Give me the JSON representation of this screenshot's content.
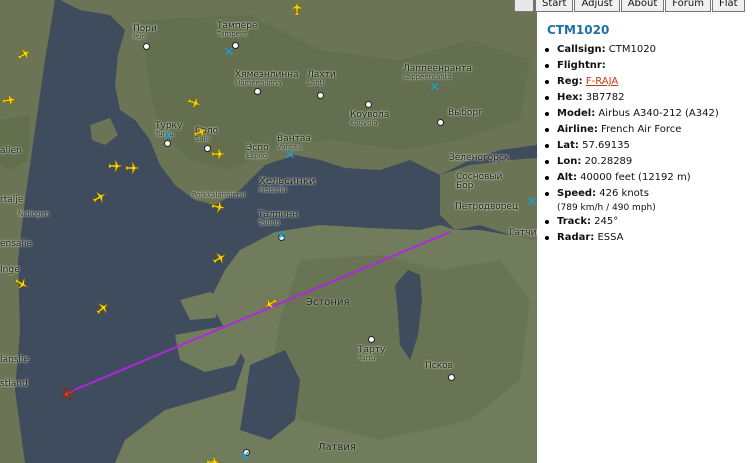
{
  "tabs": [
    "Start",
    "Adjust",
    "About",
    "Forum",
    "Flat"
  ],
  "flight": {
    "title": "CTM1020",
    "fields": [
      {
        "label": "Callsign:",
        "value": "CTM1020"
      },
      {
        "label": "Flightnr:",
        "value": ""
      },
      {
        "label": "Reg:",
        "value": "F-RAJA",
        "link": true
      },
      {
        "label": "Hex:",
        "value": "3B7782"
      },
      {
        "label": "Model:",
        "value": "Airbus A340-212 (A342)"
      },
      {
        "label": "Airline:",
        "value": "French Air Force"
      },
      {
        "label": "Lat:",
        "value": "57.69135"
      },
      {
        "label": "Lon:",
        "value": "20.28289"
      },
      {
        "label": "Alt:",
        "value": "40000 feet (12192 m)"
      },
      {
        "label": "Speed:",
        "value": "426 knots",
        "sub": "(789 km/h / 490 mph)"
      },
      {
        "label": "Track:",
        "value": "245°"
      },
      {
        "label": "Radar:",
        "value": "ESSA"
      }
    ]
  },
  "map": {
    "cities": [
      {
        "ru": "Пори",
        "lat": "Pori"
      },
      {
        "ru": "Тампере",
        "lat": "Tampere"
      },
      {
        "ru": "Хямеэнлинна",
        "lat": "Hämeenlinna"
      },
      {
        "ru": "Лахти",
        "lat": "Lahti"
      },
      {
        "ru": "Лаппеенранта",
        "lat": "Lappeenranta"
      },
      {
        "ru": "Коувола",
        "lat": "Kouvola"
      },
      {
        "ru": "Турку",
        "lat": "Turku"
      },
      {
        "ru": "Сало",
        "lat": "Salo"
      },
      {
        "ru": "Эспо",
        "lat": "Espoo"
      },
      {
        "ru": "Вантаа",
        "lat": "Vantaa"
      },
      {
        "ru": "Выборг",
        "lat": ""
      },
      {
        "ru": "Хельсинки",
        "lat": "Helsinki"
      },
      {
        "ru": "Зеленогорск",
        "lat": ""
      },
      {
        "ru": "Сосновый Бор",
        "lat": ""
      },
      {
        "ru": "Петродворец",
        "lat": ""
      },
      {
        "ru": "Гатчина",
        "lat": ""
      },
      {
        "ru": "Таллинн",
        "lat": "Tallinn"
      },
      {
        "ru": "Тарту",
        "lat": "Tartu"
      },
      {
        "ru": "Псков",
        "lat": ""
      }
    ],
    "partial_labels": [
      "allen",
      "rtalje",
      "Nidingen",
      "ensalie",
      "Inge",
      "lanslie",
      "stland",
      "Porkkalanniemi"
    ],
    "countries": [
      "Эстония",
      "Латвия"
    ],
    "colors": {
      "track": "#b025e0",
      "plane": "#ffd700",
      "selected_plane": "#e0401a",
      "radar_marker": "#1aa0d8"
    }
  }
}
